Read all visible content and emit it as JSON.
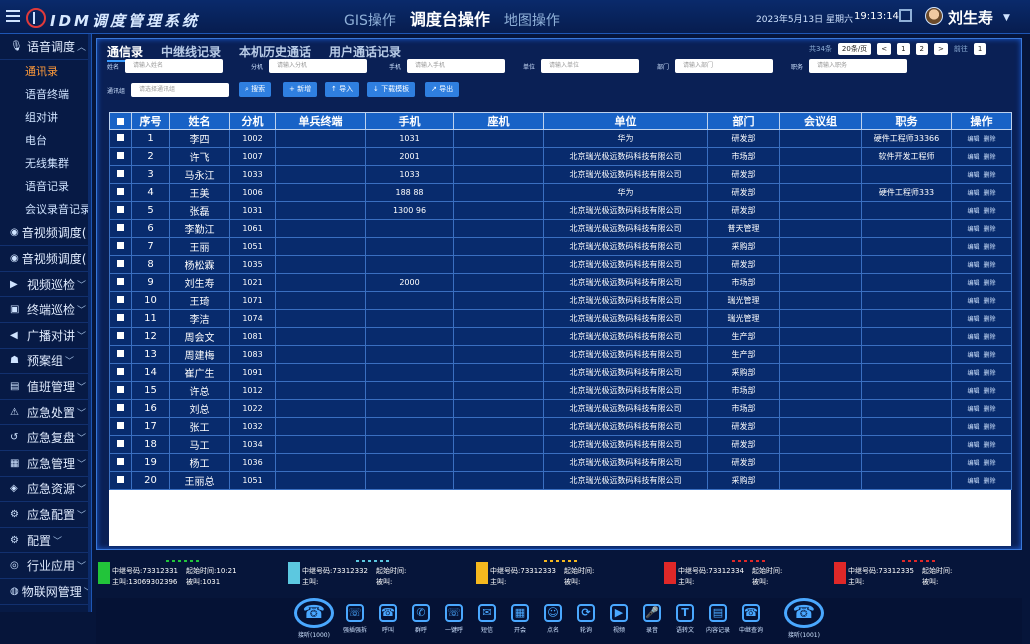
{
  "app": {
    "title": "IDM调度管理系统"
  },
  "top_tabs": [
    {
      "label": "GIS操作",
      "active": false
    },
    {
      "label": "调度台操作",
      "active": true
    },
    {
      "label": "地图操作",
      "active": false
    }
  ],
  "header": {
    "date": "2023年5月13日 星期六",
    "time": "19:13:14",
    "user": "刘生寿"
  },
  "sidebar": {
    "groups": [
      {
        "label": "语音调度",
        "icon": "mic-icon",
        "expanded": true,
        "items": [
          "通讯录",
          "语音终端",
          "组对讲",
          "电台",
          "无线集群",
          "语音记录",
          "会议录音记录"
        ]
      },
      {
        "label": "音视频调度(",
        "icon": "play-circle-icon"
      },
      {
        "label": "音视频调度(",
        "icon": "play-circle-icon"
      },
      {
        "label": "视频巡检",
        "icon": "video-icon"
      },
      {
        "label": "终端巡检",
        "icon": "terminal-icon"
      },
      {
        "label": "广播对讲",
        "icon": "speaker-icon"
      },
      {
        "label": "预案组",
        "icon": "plan-icon"
      },
      {
        "label": "值班管理",
        "icon": "duty-icon"
      },
      {
        "label": "应急处置",
        "icon": "alarm-icon"
      },
      {
        "label": "应急复盘",
        "icon": "replay-icon"
      },
      {
        "label": "应急管理",
        "icon": "manage-icon"
      },
      {
        "label": "应急资源",
        "icon": "resource-icon"
      },
      {
        "label": "应急配置",
        "icon": "config-icon"
      },
      {
        "label": "配置",
        "icon": "settings-icon"
      },
      {
        "label": "行业应用",
        "icon": "apps-icon"
      },
      {
        "label": "物联网管理",
        "icon": "iot-icon"
      }
    ],
    "active_item": "通讯录"
  },
  "sub_tabs": [
    {
      "label": "通信录",
      "active": true
    },
    {
      "label": "中继线记录",
      "active": false
    },
    {
      "label": "本机历史通话",
      "active": false
    },
    {
      "label": "用户通话记录",
      "active": false
    }
  ],
  "pager": {
    "total": "共34条",
    "page_size": "20条/页",
    "prev": "<",
    "page1": "1",
    "page2": "2",
    "next": ">",
    "goto_label": "前往",
    "goto_value": "1"
  },
  "filters": {
    "fields": [
      {
        "label": "姓名",
        "placeholder": "请输入姓名"
      },
      {
        "label": "分机",
        "placeholder": "请输入分机"
      },
      {
        "label": "手机",
        "placeholder": "请输入手机"
      },
      {
        "label": "单位",
        "placeholder": "请输入单位"
      },
      {
        "label": "部门",
        "placeholder": "请输入部门"
      },
      {
        "label": "职务",
        "placeholder": "请输入职务"
      }
    ],
    "group_label": "通讯组",
    "group_placeholder": "请选择通讯组",
    "buttons": [
      "搜索",
      "新增",
      "导入",
      "下载模板",
      "导出"
    ]
  },
  "table": {
    "columns": [
      "序号",
      "姓名",
      "分机",
      "单兵终端",
      "手机",
      "座机",
      "单位",
      "部门",
      "会议组",
      "职务",
      "操作"
    ],
    "ops": {
      "edit": "编辑",
      "delete": "删除"
    },
    "rows": [
      {
        "idx": "1",
        "name": "李四",
        "ext": "1002",
        "mobile": "1031",
        "unit": "华为",
        "dept": "研发部",
        "title": "硬件工程师33366"
      },
      {
        "idx": "2",
        "name": "许飞",
        "ext": "1007",
        "mobile": "2001",
        "unit": "北京瑞光极远数码科技有限公司",
        "dept": "市场部",
        "title": "软件开发工程师"
      },
      {
        "idx": "3",
        "name": "马永江",
        "ext": "1033",
        "mobile": "1033",
        "unit": "北京瑞光极远数码科技有限公司",
        "dept": "研发部",
        "title": ""
      },
      {
        "idx": "4",
        "name": "王美",
        "ext": "1006",
        "mobile": "188 88",
        "unit": "华为",
        "dept": "研发部",
        "title": "硬件工程师333"
      },
      {
        "idx": "5",
        "name": "张磊",
        "ext": "1031",
        "mobile": "1300 96",
        "unit": "北京瑞光极远数码科技有限公司",
        "dept": "研发部",
        "title": ""
      },
      {
        "idx": "6",
        "name": "李勤江",
        "ext": "1061",
        "mobile": "",
        "unit": "北京瑞光极远数码科技有限公司",
        "dept": "普天管理",
        "title": ""
      },
      {
        "idx": "7",
        "name": "王丽",
        "ext": "1051",
        "mobile": "",
        "unit": "北京瑞光极远数码科技有限公司",
        "dept": "采购部",
        "title": ""
      },
      {
        "idx": "8",
        "name": "杨松霖",
        "ext": "1035",
        "mobile": "",
        "unit": "北京瑞光极远数码科技有限公司",
        "dept": "研发部",
        "title": ""
      },
      {
        "idx": "9",
        "name": "刘生寿",
        "ext": "1021",
        "mobile": "2000",
        "unit": "北京瑞光极远数码科技有限公司",
        "dept": "市场部",
        "title": ""
      },
      {
        "idx": "10",
        "name": "王琦",
        "ext": "1071",
        "mobile": "",
        "unit": "北京瑞光极远数码科技有限公司",
        "dept": "瑞光管理",
        "title": ""
      },
      {
        "idx": "11",
        "name": "李洁",
        "ext": "1074",
        "mobile": "",
        "unit": "北京瑞光极远数码科技有限公司",
        "dept": "瑞光管理",
        "title": ""
      },
      {
        "idx": "12",
        "name": "周会文",
        "ext": "1081",
        "mobile": "",
        "unit": "北京瑞光极远数码科技有限公司",
        "dept": "生产部",
        "title": ""
      },
      {
        "idx": "13",
        "name": "周建梅",
        "ext": "1083",
        "mobile": "",
        "unit": "北京瑞光极远数码科技有限公司",
        "dept": "生产部",
        "title": ""
      },
      {
        "idx": "14",
        "name": "崔广生",
        "ext": "1091",
        "mobile": "",
        "unit": "北京瑞光极远数码科技有限公司",
        "dept": "采购部",
        "title": ""
      },
      {
        "idx": "15",
        "name": "许总",
        "ext": "1012",
        "mobile": "",
        "unit": "北京瑞光极远数码科技有限公司",
        "dept": "市场部",
        "title": ""
      },
      {
        "idx": "16",
        "name": "刘总",
        "ext": "1022",
        "mobile": "",
        "unit": "北京瑞光极远数码科技有限公司",
        "dept": "市场部",
        "title": ""
      },
      {
        "idx": "17",
        "name": "张工",
        "ext": "1032",
        "mobile": "",
        "unit": "北京瑞光极远数码科技有限公司",
        "dept": "研发部",
        "title": ""
      },
      {
        "idx": "18",
        "name": "马工",
        "ext": "1034",
        "mobile": "",
        "unit": "北京瑞光极远数码科技有限公司",
        "dept": "研发部",
        "title": ""
      },
      {
        "idx": "19",
        "name": "杨工",
        "ext": "1036",
        "mobile": "",
        "unit": "北京瑞光极远数码科技有限公司",
        "dept": "研发部",
        "title": ""
      },
      {
        "idx": "20",
        "name": "王丽总",
        "ext": "1051",
        "mobile": "",
        "unit": "北京瑞光极远数码科技有限公司",
        "dept": "采购部",
        "title": ""
      }
    ]
  },
  "call_cards": [
    {
      "color_a": "#22c43a",
      "color_b": "#22c43a",
      "relay_label": "中继号码:",
      "relay": "73312331",
      "start_label": "起始时间:",
      "start": "10:21",
      "caller_label": "主叫:",
      "caller": "13069302396",
      "callee_label": "被叫:",
      "callee": "1031"
    },
    {
      "color_a": "#5cc8e0",
      "color_b": "#5cc8e0",
      "relay_label": "中继号码:",
      "relay": "73312332",
      "start_label": "起始时间:",
      "start": "",
      "caller_label": "主叫:",
      "caller": "",
      "callee_label": "被叫:",
      "callee": ""
    },
    {
      "color_a": "#f5b81e",
      "color_b": "#f5b81e",
      "relay_label": "中继号码:",
      "relay": "73312333",
      "start_label": "起始时间:",
      "start": "",
      "caller_label": "主叫:",
      "caller": "",
      "callee_label": "被叫:",
      "callee": ""
    },
    {
      "color_a": "#e02828",
      "color_b": "#e02828",
      "relay_label": "中继号码:",
      "relay": "73312334",
      "start_label": "起始时间:",
      "start": "",
      "caller_label": "主叫:",
      "caller": "",
      "callee_label": "被叫:",
      "callee": ""
    },
    {
      "color_a": "#e02828",
      "color_b": "#e02828",
      "relay_label": "中继号码:",
      "relay": "73312335",
      "start_label": "起始时间:",
      "start": "",
      "caller_label": "主叫:",
      "caller": "",
      "callee_label": "被叫:",
      "callee": ""
    }
  ],
  "toolbar": {
    "left_phone": "接听(1000)",
    "right_phone": "接听(1001)",
    "tools": [
      {
        "label": "强插强拆",
        "icon": "phone-icon"
      },
      {
        "label": "呼叫",
        "icon": "call-icon"
      },
      {
        "label": "群呼",
        "icon": "group-call-icon"
      },
      {
        "label": "一键呼",
        "icon": "one-key-icon"
      },
      {
        "label": "短信",
        "icon": "sms-icon"
      },
      {
        "label": "开会",
        "icon": "meeting-icon"
      },
      {
        "label": "点名",
        "icon": "rollcall-icon"
      },
      {
        "label": "轮询",
        "icon": "loop-icon"
      },
      {
        "label": "视频",
        "icon": "video-call-icon"
      },
      {
        "label": "录音",
        "icon": "record-icon"
      },
      {
        "label": "语转文",
        "icon": "speech-text-icon"
      },
      {
        "label": "内容记录",
        "icon": "notes-icon"
      },
      {
        "label": "中继查询",
        "icon": "relay-query-icon"
      }
    ]
  }
}
